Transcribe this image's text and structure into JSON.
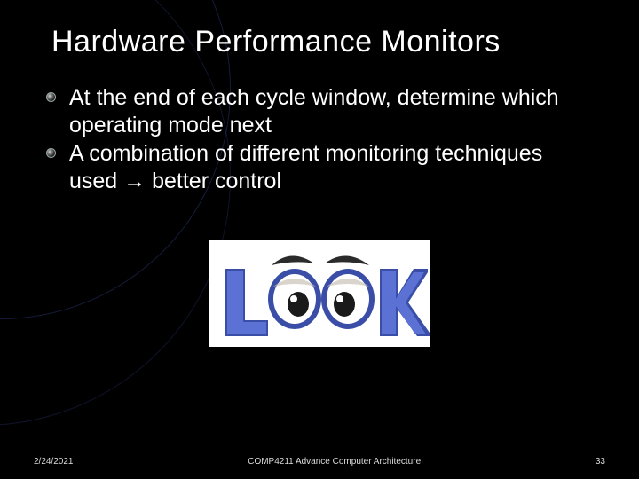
{
  "title": "Hardware Performance Monitors",
  "bullets": [
    "At the end of each cycle window, determine which operating mode next",
    "A combination of different monitoring techniques used → better control"
  ],
  "image": {
    "name": "look-logo",
    "alt": "LOOK logo with eyes replacing the two O letters"
  },
  "footer": {
    "date": "2/24/2021",
    "center": "COMP4211 Advance Computer Architecture",
    "page": "33"
  }
}
